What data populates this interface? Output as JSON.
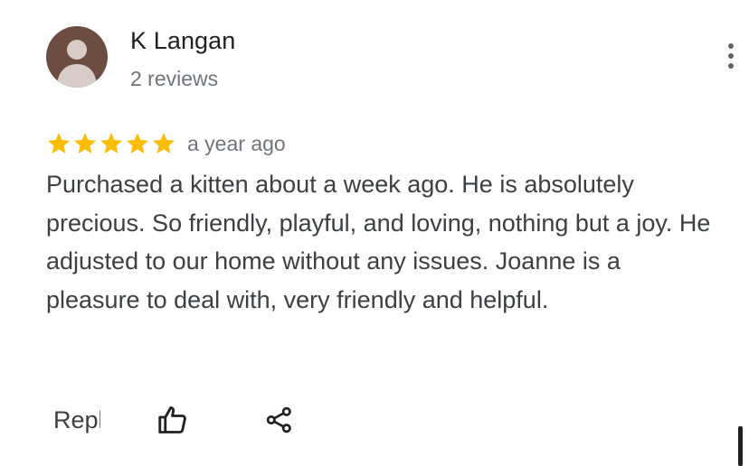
{
  "reviewer": {
    "name": "K Langan",
    "meta": "2 reviews"
  },
  "review": {
    "rating": 5,
    "max_rating": 5,
    "date": "a year ago",
    "text": "Purchased a kitten about a week ago.  He is absolutely precious.  So friendly, playful,  and loving, nothing but a joy.  He adjusted to our home without any issues.  Joanne is a pleasure to deal with, very friendly and helpful."
  },
  "actions": {
    "reply_label": "Reply"
  },
  "icons": {
    "avatar": "person-avatar-icon",
    "more": "more-vert-icon",
    "star": "star-icon",
    "like": "thumb-up-icon",
    "share": "share-icon"
  },
  "colors": {
    "avatar_bg": "#6d4c41",
    "avatar_figure": "#d7ccc8",
    "star": "#fbbc04",
    "text_primary": "#202124",
    "text_body": "#3c4043",
    "text_secondary": "#70757a",
    "icon": "#5f6368"
  }
}
